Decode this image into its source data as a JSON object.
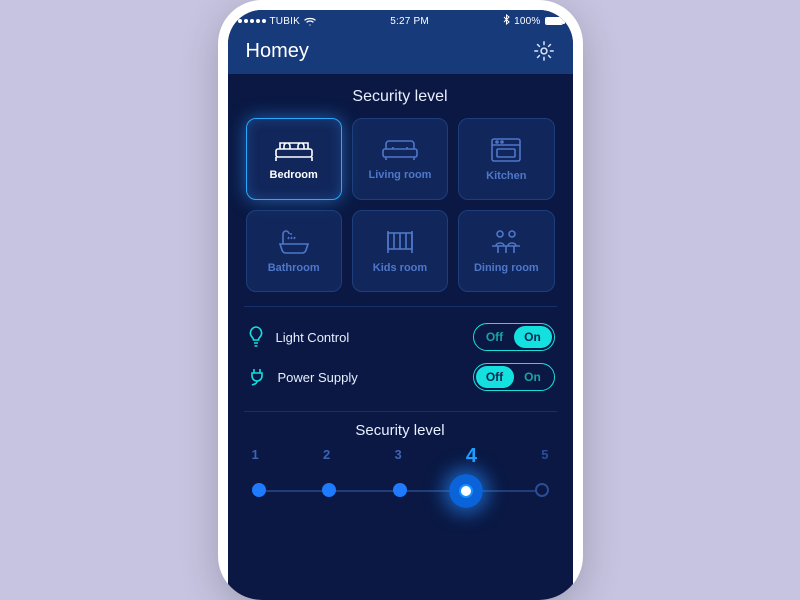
{
  "status": {
    "carrier": "TUBIK",
    "time": "5:27 PM",
    "battery": "100%"
  },
  "header": {
    "title": "Homey"
  },
  "section_title": "Security level",
  "rooms": [
    {
      "label": "Bedroom",
      "active": true
    },
    {
      "label": "Living room",
      "active": false
    },
    {
      "label": "Kitchen",
      "active": false
    },
    {
      "label": "Bathroom",
      "active": false
    },
    {
      "label": "Kids room",
      "active": false
    },
    {
      "label": "Dining room",
      "active": false
    }
  ],
  "controls": {
    "light": {
      "label": "Light Control",
      "off": "Off",
      "on": "On",
      "value": "On"
    },
    "power": {
      "label": "Power Supply",
      "off": "Off",
      "on": "On",
      "value": "Off"
    }
  },
  "slider": {
    "title": "Security level",
    "levels": [
      "1",
      "2",
      "3",
      "4",
      "5"
    ],
    "value_index": 3
  },
  "colors": {
    "accent": "#1ea0ff",
    "cyan": "#15e0e0",
    "bg": "#0a1843"
  }
}
